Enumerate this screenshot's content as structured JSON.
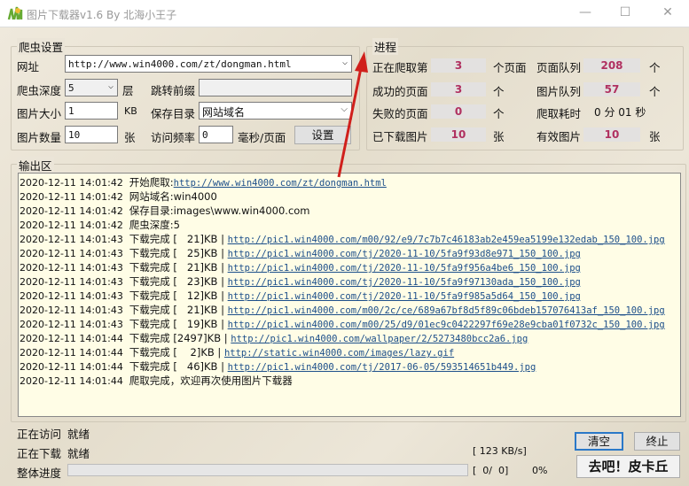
{
  "window": {
    "title": "图片下载器v1.6 By 北海小王子",
    "minimize": "—",
    "maximize": "☐",
    "close": "✕"
  },
  "settings": {
    "group_label": "爬虫设置",
    "url_label": "网址",
    "url_value": "http://www.win4000.com/zt/dongman.html",
    "depth_label": "爬虫深度",
    "depth_value": "5",
    "depth_unit": "层",
    "prefix_label": "跳转前缀",
    "prefix_value": "",
    "size_label": "图片大小",
    "size_value": "1",
    "size_unit": "KB",
    "savedir_label": "保存目录",
    "savedir_value": "网站域名",
    "count_label": "图片数量",
    "count_value": "10",
    "count_unit": "张",
    "freq_label": "访问频率",
    "freq_value": "0",
    "freq_unit": "毫秒/页面",
    "set_button": "设置"
  },
  "progress_group": {
    "group_label": "进程",
    "crawling_label": "正在爬取第",
    "crawling_value": "3",
    "crawling_unit": "个页面",
    "page_queue_label": "页面队列",
    "page_queue_value": "208",
    "page_queue_unit": "个",
    "success_label": "成功的页面",
    "success_value": "3",
    "success_unit": "个",
    "image_queue_label": "图片队列",
    "image_queue_value": "57",
    "image_queue_unit": "个",
    "failed_label": "失败的页面",
    "failed_value": "0",
    "failed_unit": "个",
    "elapsed_label": "爬取耗时",
    "elapsed_value": "0 分 01 秒",
    "downloaded_label": "已下载图片",
    "downloaded_value": "10",
    "downloaded_unit": "张",
    "valid_label": "有效图片",
    "valid_value": "10",
    "valid_unit": "张"
  },
  "output": {
    "label": "输出区",
    "lines": [
      {
        "ts": "2020-12-11 14:01:42",
        "msg": "开始爬取:",
        "link": "http://www.win4000.com/zt/dongman.html"
      },
      {
        "ts": "2020-12-11 14:01:42",
        "msg": "网站域名:win4000",
        "link": ""
      },
      {
        "ts": "2020-12-11 14:01:42",
        "msg": "保存目录:images\\www.win4000.com",
        "link": ""
      },
      {
        "ts": "2020-12-11 14:01:42",
        "msg": "爬虫深度:5",
        "link": ""
      },
      {
        "ts": "2020-12-11 14:01:43",
        "msg": "下载完成 [   21]KB | ",
        "link": "http://pic1.win4000.com/m00/92/e9/7c7b7c46183ab2e459ea5199e132edab_150_100.jpg"
      },
      {
        "ts": "2020-12-11 14:01:43",
        "msg": "下载完成 [   25]KB | ",
        "link": "http://pic1.win4000.com/tj/2020-11-10/5fa9f93d8e971_150_100.jpg"
      },
      {
        "ts": "2020-12-11 14:01:43",
        "msg": "下载完成 [   21]KB | ",
        "link": "http://pic1.win4000.com/tj/2020-11-10/5fa9f956a4be6_150_100.jpg"
      },
      {
        "ts": "2020-12-11 14:01:43",
        "msg": "下载完成 [   23]KB | ",
        "link": "http://pic1.win4000.com/tj/2020-11-10/5fa9f97130ada_150_100.jpg"
      },
      {
        "ts": "2020-12-11 14:01:43",
        "msg": "下载完成 [   12]KB | ",
        "link": "http://pic1.win4000.com/tj/2020-11-10/5fa9f985a5d64_150_100.jpg"
      },
      {
        "ts": "2020-12-11 14:01:43",
        "msg": "下载完成 [   21]KB | ",
        "link": "http://pic1.win4000.com/m00/2c/ce/689a67bf8d5f89c06bdeb157076413af_150_100.jpg"
      },
      {
        "ts": "2020-12-11 14:01:43",
        "msg": "下载完成 [   19]KB | ",
        "link": "http://pic1.win4000.com/m00/25/d9/01ec9c0422297f69e28e9cba01f0732c_150_100.jpg"
      },
      {
        "ts": "2020-12-11 14:01:44",
        "msg": "下载完成 [2497]KB | ",
        "link": "http://pic1.win4000.com/wallpaper/2/5273480bcc2a6.jpg"
      },
      {
        "ts": "2020-12-11 14:01:44",
        "msg": "下载完成 [    2]KB | ",
        "link": "http://static.win4000.com/images/lazy.gif"
      },
      {
        "ts": "2020-12-11 14:01:44",
        "msg": "下载完成 [   46]KB | ",
        "link": "http://pic1.win4000.com/tj/2017-06-05/593514651b449.jpg"
      },
      {
        "ts": "2020-12-11 14:01:44",
        "msg": "爬取完成，欢迎再次使用图片下载器",
        "link": ""
      }
    ]
  },
  "status": {
    "visiting_label": "正在访问",
    "visiting_value": "就绪",
    "downloading_label": "正在下载",
    "downloading_value": "就绪",
    "overall_label": "整体进度",
    "overall_percent": 0,
    "speed": "[ 123 KB/s]",
    "count": "[  0/  0]",
    "percent_text": "0%"
  },
  "buttons": {
    "clear": "清空",
    "stop": "终止",
    "go": "去吧！皮卡丘"
  },
  "colors": {
    "value_text": "#b03060",
    "log_bg": "#fffde6",
    "link": "#1d4f8a",
    "arrow": "#d0201c"
  }
}
